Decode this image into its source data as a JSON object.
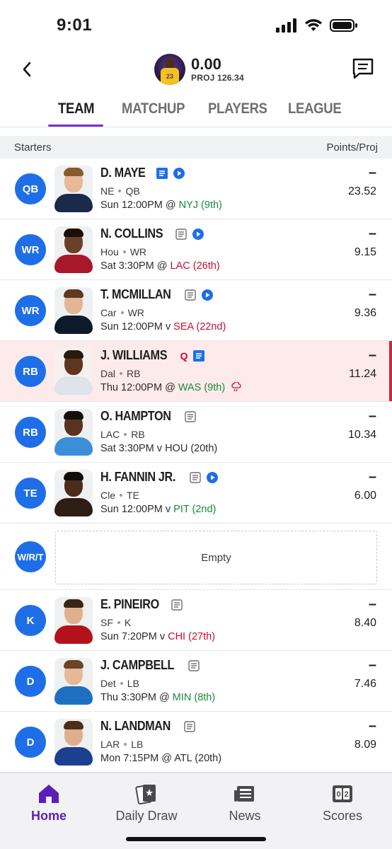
{
  "status": {
    "time": "9:01"
  },
  "header": {
    "score": "0.00",
    "proj": "PROJ 126.34"
  },
  "tabs": [
    "TEAM",
    "MATCHUP",
    "PLAYERS",
    "LEAGUE"
  ],
  "section": {
    "title": "Starters",
    "right": "Points/Proj"
  },
  "players": [
    {
      "pos": "QB",
      "name": "D. MAYE",
      "team": "NE",
      "position": "QB",
      "game": "Sun 12:00PM @ ",
      "opp": "NYJ (9th)",
      "opp_status": "good",
      "pts": "–",
      "proj": "23.52",
      "news_active": true,
      "video": true,
      "injury": ""
    },
    {
      "pos": "WR",
      "name": "N. COLLINS",
      "team": "Hou",
      "position": "WR",
      "game": "Sat 3:30PM @ ",
      "opp": "LAC (26th)",
      "opp_status": "bad",
      "pts": "–",
      "proj": "9.15",
      "news_active": false,
      "video": true,
      "injury": ""
    },
    {
      "pos": "WR",
      "name": "T. MCMILLAN",
      "team": "Car",
      "position": "WR",
      "game": "Sun 12:00PM v ",
      "opp": "SEA (22nd)",
      "opp_status": "bad",
      "pts": "–",
      "proj": "9.36",
      "news_active": false,
      "video": true,
      "injury": ""
    },
    {
      "pos": "RB",
      "name": "J. WILLIAMS",
      "team": "Dal",
      "position": "RB",
      "game": "Thu 12:00PM @ ",
      "opp": "WAS (9th)",
      "opp_status": "good",
      "pts": "–",
      "proj": "11.24",
      "news_active": true,
      "video": false,
      "injury": "Q"
    },
    {
      "pos": "RB",
      "name": "O. HAMPTON",
      "team": "LAC",
      "position": "RB",
      "game": "Sat 3:30PM v ",
      "opp": "HOU (20th)",
      "opp_status": "neutral",
      "pts": "–",
      "proj": "10.34",
      "news_active": false,
      "video": false,
      "injury": ""
    },
    {
      "pos": "TE",
      "name": "H. FANNIN JR.",
      "team": "Cle",
      "position": "TE",
      "game": "Sun 12:00PM v ",
      "opp": "PIT (2nd)",
      "opp_status": "good",
      "pts": "–",
      "proj": "6.00",
      "news_active": false,
      "video": true,
      "injury": ""
    }
  ],
  "flex_slot": {
    "pos": "W/R/T",
    "label": "Empty"
  },
  "bench_players": [
    {
      "pos": "K",
      "name": "E. PINEIRO",
      "team": "SF",
      "position": "K",
      "game": "Sun 7:20PM v ",
      "opp": "CHI (27th)",
      "opp_status": "bad",
      "pts": "–",
      "proj": "8.40",
      "news_active": false
    },
    {
      "pos": "D",
      "name": "J. CAMPBELL",
      "team": "Det",
      "position": "LB",
      "game": "Thu 3:30PM @ ",
      "opp": "MIN (8th)",
      "opp_status": "good",
      "pts": "–",
      "proj": "7.46",
      "news_active": false
    },
    {
      "pos": "D",
      "name": "N. LANDMAN",
      "team": "LAR",
      "position": "LB",
      "game": "Mon 7:15PM @ ",
      "opp": "ATL (20th)",
      "opp_status": "neutral",
      "pts": "–",
      "proj": "8.09",
      "news_active": false
    }
  ],
  "nav": [
    {
      "label": "Home",
      "icon": "home-icon",
      "active": true
    },
    {
      "label": "Daily Draw",
      "icon": "daily-draw-icon",
      "active": false
    },
    {
      "label": "News",
      "icon": "news-icon",
      "active": false
    },
    {
      "label": "Scores",
      "icon": "scores-icon",
      "active": false
    }
  ],
  "colors": {
    "accent": "#7b2bd9",
    "position_blue": "#1e6ee8",
    "good": "#1a8a3a",
    "bad": "#c8102e",
    "injured_bg": "#fdeaea"
  }
}
